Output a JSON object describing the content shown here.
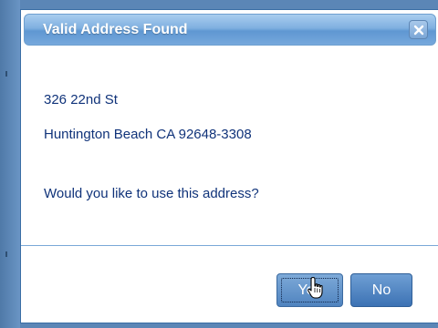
{
  "dialog": {
    "title": "Valid Address Found",
    "close_icon": "close-x-icon",
    "address_line1": "326 22nd St",
    "address_line2": "Huntington Beach CA 92648-3308",
    "question": "Would you like to use this address?",
    "yes_label": "Yes",
    "no_label": "No"
  },
  "colors": {
    "text": "#10337a",
    "titlebar": "#76a8dc",
    "button": "#4f83bf",
    "backdrop": "#5b86b6"
  },
  "cursor": {
    "icon": "hand-pointer-icon"
  }
}
